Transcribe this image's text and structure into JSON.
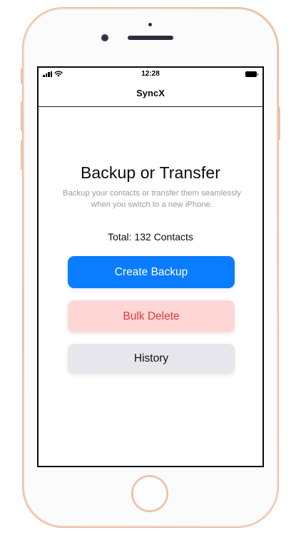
{
  "status_bar": {
    "time": "12:28"
  },
  "nav": {
    "title": "SyncX"
  },
  "main": {
    "headline": "Backup or Transfer",
    "subtitle": "Backup your contacts or transfer them seamlessly when you switch to a new iPhone.",
    "total": "Total: 132 Contacts"
  },
  "buttons": {
    "create_backup": "Create Backup",
    "bulk_delete": "Bulk Delete",
    "history": "History"
  },
  "colors": {
    "primary": "#0a7cff",
    "danger_bg": "#ffd6d6",
    "danger_text": "#e03a3a",
    "neutral_bg": "#e6e6ec",
    "phone_frame": "#f0c8ad"
  },
  "icons": [
    "cellular-signal-icon",
    "wifi-icon",
    "battery-icon"
  ]
}
